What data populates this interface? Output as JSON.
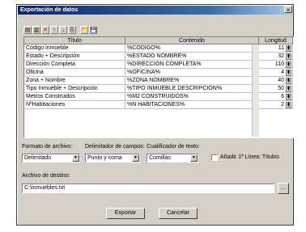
{
  "window": {
    "title": "Exportación de datos",
    "close_glyph": "×"
  },
  "toolbar": {
    "icons": [
      "insert-row-icon",
      "delete-row-icon",
      "delete-icon",
      "move-up-icon",
      "move-down-icon",
      "properties-icon",
      "open-icon",
      "save-icon"
    ],
    "glyphs": [
      "▤",
      "▥",
      "✕",
      "↑",
      "↓",
      "⎘",
      "📂",
      "💾"
    ]
  },
  "grid": {
    "headers": {
      "title": "Título",
      "content": "Contenido",
      "length": "Longitud"
    },
    "rows": [
      {
        "title": "Código inmueble",
        "content": "%CODIGO%",
        "length": "11"
      },
      {
        "title": "Estado + Descripción",
        "content": "%ESTADO NOMBRE%",
        "length": "32"
      },
      {
        "title": "Dirección Completa",
        "content": "%DIRECCION COMPLETA%",
        "length": "110"
      },
      {
        "title": "Oficina",
        "content": "%OFICINA%",
        "length": "4"
      },
      {
        "title": "Zona + Nombre",
        "content": "%ZONA NOMBRE%",
        "length": "40"
      },
      {
        "title": "Tipo Inmueble + Descripción",
        "content": "%TIPO INMUEBLE DESCRIPCION%",
        "length": "50"
      },
      {
        "title": "Metros Construidos",
        "content": "%M2 CONSTRUIDOS%",
        "length": "6"
      },
      {
        "title": "NºHabitaciones",
        "content": "%N HABITACIONES%",
        "length": "2"
      }
    ]
  },
  "options": {
    "format_label": "Formato de archivo:",
    "format_value": "Delimitado",
    "delimiter_label": "Delimitador de campos:",
    "delimiter_value": "Punto y coma",
    "qualifier_label": "Cualificador de texto:",
    "qualifier_value": "Comillas",
    "add_first_line_label": "Añadir 1ª Línea: Títulos"
  },
  "destination": {
    "label": "Archivo de destino:",
    "value": "C:\\inmuebles.txt",
    "browse": "..."
  },
  "buttons": {
    "export": "Exportar",
    "cancel": "Cancelar"
  }
}
